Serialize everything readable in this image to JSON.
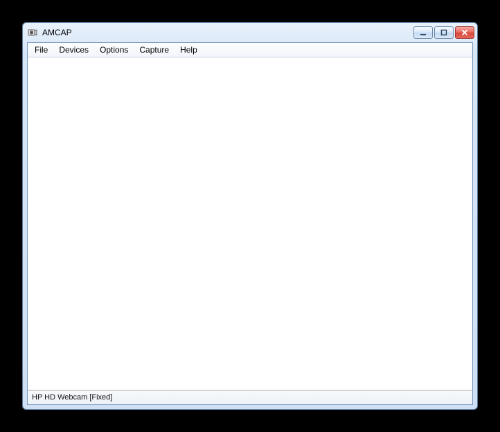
{
  "window": {
    "title": "AMCAP"
  },
  "menu": {
    "file": "File",
    "devices": "Devices",
    "options": "Options",
    "capture": "Capture",
    "help": "Help"
  },
  "status": {
    "text": "HP HD Webcam [Fixed]"
  }
}
